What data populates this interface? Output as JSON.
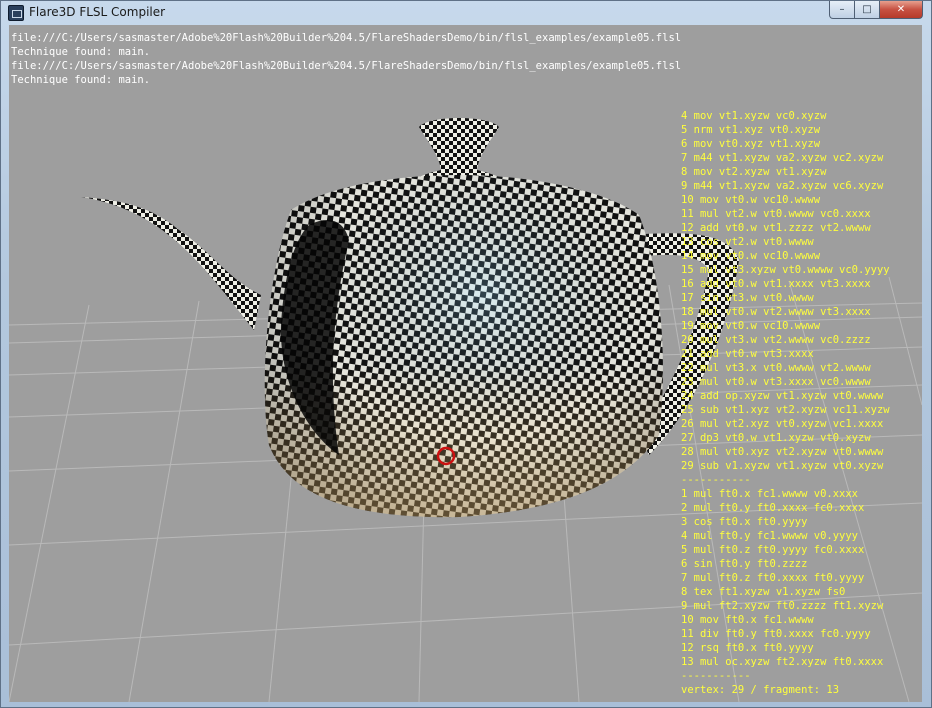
{
  "window": {
    "title": "Flare3D FLSL Compiler",
    "controls": {
      "minimize": "–",
      "maximize": "□",
      "close": "✕"
    }
  },
  "log": [
    "file:///C:/Users/sasmaster/Adobe%20Flash%20Builder%204.5/FlareShadersDemo/bin/flsl_examples/example05.flsl",
    "Technique found: main.",
    "file:///C:/Users/sasmaster/Adobe%20Flash%20Builder%204.5/FlareShadersDemo/bin/flsl_examples/example05.flsl",
    "Technique found: main."
  ],
  "vertex_program": [
    "4 mov vt1.xyzw vc0.xyzw",
    "5 nrm vt1.xyz vt0.xyzw",
    "6 mov vt0.xyz vt1.xyzw",
    "7 m44 vt1.xyzw va2.xyzw vc2.xyzw",
    "8 mov vt2.xyzw vt1.xyzw",
    "9 m44 vt1.xyzw va2.xyzw vc6.xyzw",
    "10 mov vt0.w vc10.wwww",
    "11 mul vt2.w vt0.wwww vc0.xxxx",
    "12 add vt0.w vt1.zzzz vt2.wwww",
    "13 cos vt2.w vt0.wwww",
    "14 mov vt0.w vc10.wwww",
    "15 mul vt3.xyzw vt0.wwww vc0.yyyy",
    "16 add vt0.w vt1.xxxx vt3.xxxx",
    "17 sin vt3.w vt0.wwww",
    "18 mul vt0.w vt2.wwww vt3.xxxx",
    "19 mov vt0.w vc10.wwww",
    "20 mul vt3.w vt2.wwww vc0.zzzz",
    "21 add vt0.w vt3.xxxx",
    "22 mul vt3.x vt0.wwww vt2.wwww",
    "23 mul vt0.w vt3.xxxx vc0.wwww",
    "24 add op.xyzw vt1.xyzw vt0.wwww",
    "25 sub vt1.xyz vt2.xyzw vc11.xyzw",
    "26 mul vt2.xyz vt0.xyzw vc1.xxxx",
    "27 dp3 vt0.w vt1.xyzw vt0.xyzw",
    "28 mul vt0.xyz vt2.xyzw vt0.wwww",
    "29 sub v1.xyzw vt1.xyzw vt0.xyzw"
  ],
  "separator": "-----------",
  "fragment_program": [
    "1 mul ft0.x fc1.wwww v0.xxxx",
    "2 mul ft0.y ft0.xxxx fc0.xxxx",
    "3 cos ft0.x ft0.yyyy",
    "4 mul ft0.y fc1.wwww v0.yyyy",
    "5 mul ft0.z ft0.yyyy fc0.xxxx",
    "6 sin ft0.y ft0.zzzz",
    "7 mul ft0.z ft0.xxxx ft0.yyyy",
    "8 tex ft1.xyzw v1.xyzw fs0",
    "9 mul ft2.xyzw ft0.zzzz ft1.xyzw",
    "10 mov ft0.x fc1.wwww",
    "11 div ft0.y ft0.xxxx fc0.yyyy",
    "12 rsq ft0.x ft0.yyyy",
    "13 mul oc.xyzw ft2.xyzw ft0.xxxx"
  ],
  "stats": "vertex: 29 / fragment: 13",
  "colors": {
    "viewport_bg": "#9e9e9e",
    "log_text": "#ffffff",
    "asm_text": "#ffff3c",
    "grid_line": "#b9b9b9",
    "cursor_ring": "#cc1111"
  }
}
